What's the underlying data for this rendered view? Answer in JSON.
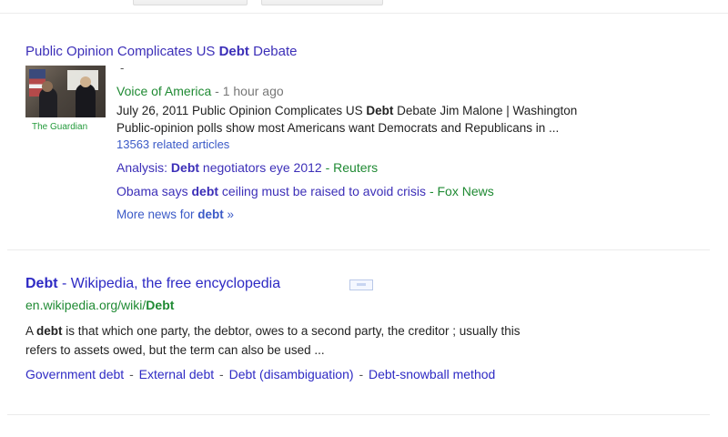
{
  "top_buttons": [
    {
      "label": ""
    },
    {
      "label": ""
    }
  ],
  "news": {
    "headline_before": "Public Opinion Complicates US ",
    "headline_bold": "Debt",
    "headline_after": " Debate",
    "dash": "-",
    "thumb_source": "The Guardian",
    "source": "Voice of America",
    "time": "- 1 hour ago",
    "snippet_line1_before": "July 26, 2011 Public Opinion Complicates US ",
    "snippet_line1_bold": "Debt",
    "snippet_line1_after": " Debate Jim Malone | Washington",
    "snippet_line2": "Public-opinion polls show most Americans want Democrats and Republicans in ...",
    "related": "13563 related articles",
    "sub1_before": "Analysis: ",
    "sub1_bold": "Debt",
    "sub1_after": " negotiators eye 2012",
    "sub1_source": "- Reuters",
    "sub2_before": "Obama says ",
    "sub2_bold": "debt",
    "sub2_after": " ceiling must be raised to avoid crisis",
    "sub2_source": "- Fox News",
    "more_before": "More news for ",
    "more_bold": "debt",
    "more_after": " »"
  },
  "wiki": {
    "title_bold": "Debt",
    "title_rest": " - Wikipedia, the free encyclopedia",
    "url_before": "en.wikipedia.org/wiki/",
    "url_bold": "Debt",
    "desc_before": "A ",
    "desc_bold": "debt",
    "desc_line1_after": " is that which one party, the debtor, owes to a second party, the creditor ; usually this",
    "desc_line2": "refers to assets owed, but the term can also be used ...",
    "sitelinks": [
      "Government debt",
      "External debt",
      "Debt (disambiguation)",
      "Debt-snowball method"
    ],
    "sitelink_separator": "-"
  }
}
